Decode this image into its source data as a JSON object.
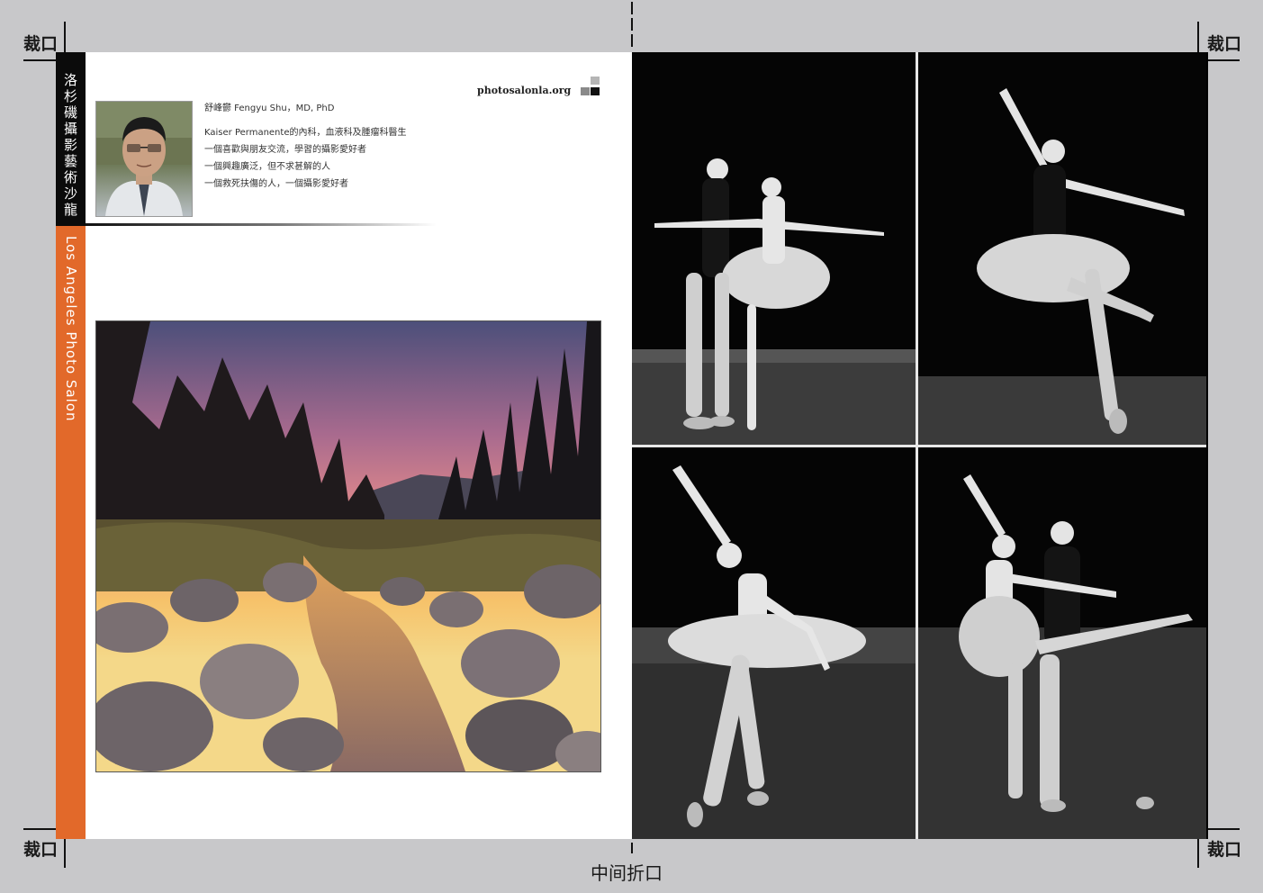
{
  "crop_marks": {
    "top_left": "裁口",
    "top_right": "裁口",
    "bottom_left": "裁口",
    "bottom_right": "裁口",
    "center_fold": "中间折口"
  },
  "sidebar": {
    "title_cn": [
      "洛",
      "杉",
      "磯",
      "攝",
      "影",
      "藝",
      "術",
      "沙",
      "龍"
    ],
    "title_en": "Los Angeles Photo Salon"
  },
  "header": {
    "logo": "photosalonla.org"
  },
  "author": {
    "name": "舒峰鬱  Fengyu Shu，MD, PhD",
    "bio": [
      "Kaiser Permanente的內科，血液科及腫瘤科醫生",
      "一個喜歡與朋友交流，學習的攝影愛好者",
      "一個興趣廣泛，但不求甚解的人",
      "一個救死扶傷的人，一個攝影愛好者"
    ]
  },
  "colors": {
    "sidebar_black": "#0b0b0b",
    "sidebar_orange": "#e2692a",
    "bleed_gray": "#c8c8ca"
  },
  "images": {
    "portrait": "author-portrait",
    "landscape": "river-sunset-landscape",
    "ballet": [
      "ballet-pas-de-deux-1",
      "ballet-solo-arabesque",
      "ballet-solo-arms-raised",
      "ballet-pas-de-deux-2"
    ]
  }
}
